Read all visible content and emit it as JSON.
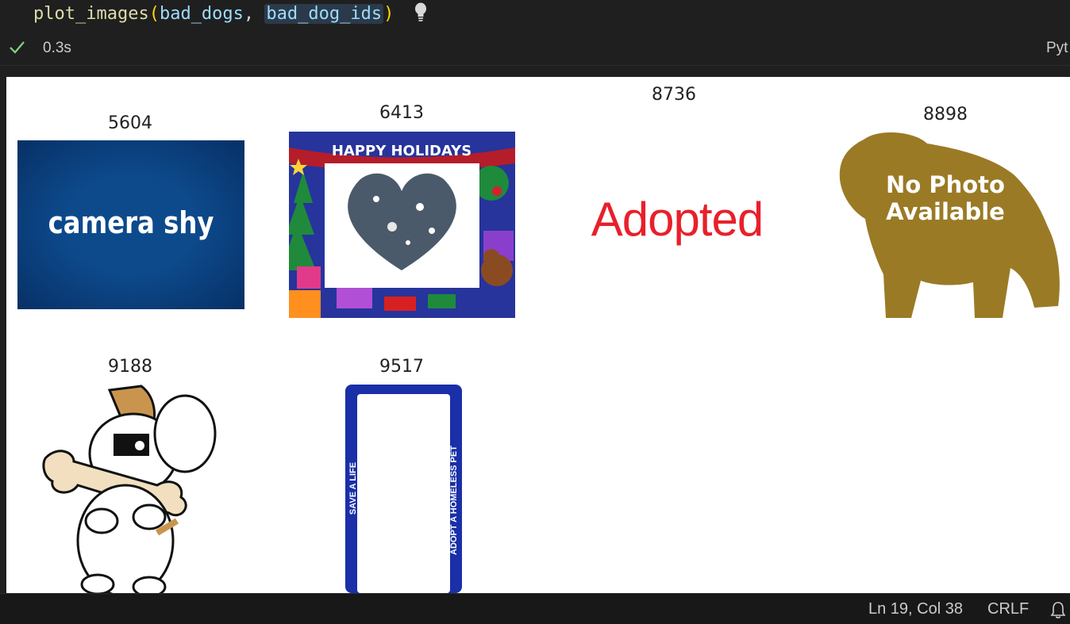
{
  "cell": {
    "code": {
      "func": "plot_images",
      "arg1": "bad_dogs",
      "sep": ", ",
      "arg2": "bad_dog_ids"
    },
    "status": "0.3s",
    "language": "Pyt"
  },
  "output": {
    "tiles": [
      {
        "id": "5604",
        "caption": "camera shy"
      },
      {
        "id": "6413",
        "caption": "HAPPY HOLIDAYS"
      },
      {
        "id": "8736",
        "caption": "Adopted"
      },
      {
        "id": "8898",
        "caption_line1": "No Photo",
        "caption_line2": "Available"
      },
      {
        "id": "9188"
      },
      {
        "id": "9517",
        "left_text": "SAVE A LIFE",
        "right_text": "ADOPT A HOMELESS PET"
      }
    ]
  },
  "statusbar": {
    "position": "Ln 19, Col 38",
    "eol": "CRLF"
  },
  "colors": {
    "camera_shy_bg": "#0d4a8c",
    "adopted_red": "#e8202a",
    "no_photo_gold": "#9a7a25",
    "plate_blue": "#1a2fa8"
  },
  "icons": [
    "lightbulb-icon",
    "check-icon",
    "bell-icon"
  ]
}
